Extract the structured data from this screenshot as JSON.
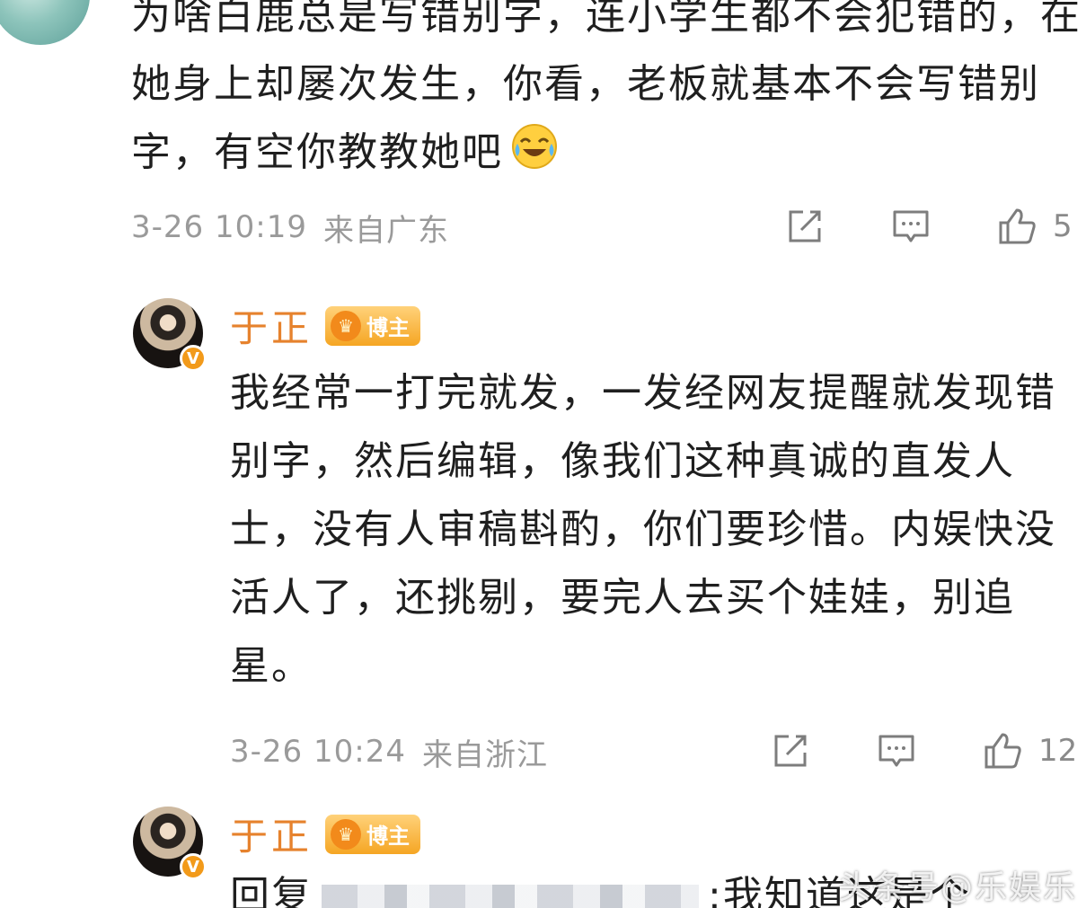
{
  "comment_top": {
    "text": "为啥白鹿总是写错别字，连小学生都不会犯错的，在她身上却屡次发生，你看，老板就基本不会写错别字，有空你教教她吧",
    "emoji": "laughing-crying-emoji",
    "time": "3-26 10:19",
    "location": "来自广东",
    "like_count": "5"
  },
  "reply_1": {
    "author": "于正",
    "badge_label": "博主",
    "text": "我经常一打完就发，一发经网友提醒就发现错别字，然后编辑，像我们这种真诚的直发人士，没有人审稿斟酌，你们要珍惜。内娱快没活人了，还挑剔，要完人去买个娃娃，别追星。",
    "time": "3-26 10:24",
    "location": "来自浙江",
    "like_count": "12"
  },
  "reply_2": {
    "author": "于正",
    "badge_label": "博主",
    "text_prefix": "回复",
    "text_suffix": ":我知道这是个"
  },
  "watermark": "头条号@乐娱乐",
  "icons": {
    "share": "share-icon",
    "comment": "comment-icon",
    "like": "thumbs-up-icon",
    "verified": "verified-v-icon",
    "crown": "crown-icon"
  },
  "colors": {
    "author_name": "#e6822d",
    "meta_gray": "#9a9a9a",
    "badge_orange": "#f5a623"
  }
}
